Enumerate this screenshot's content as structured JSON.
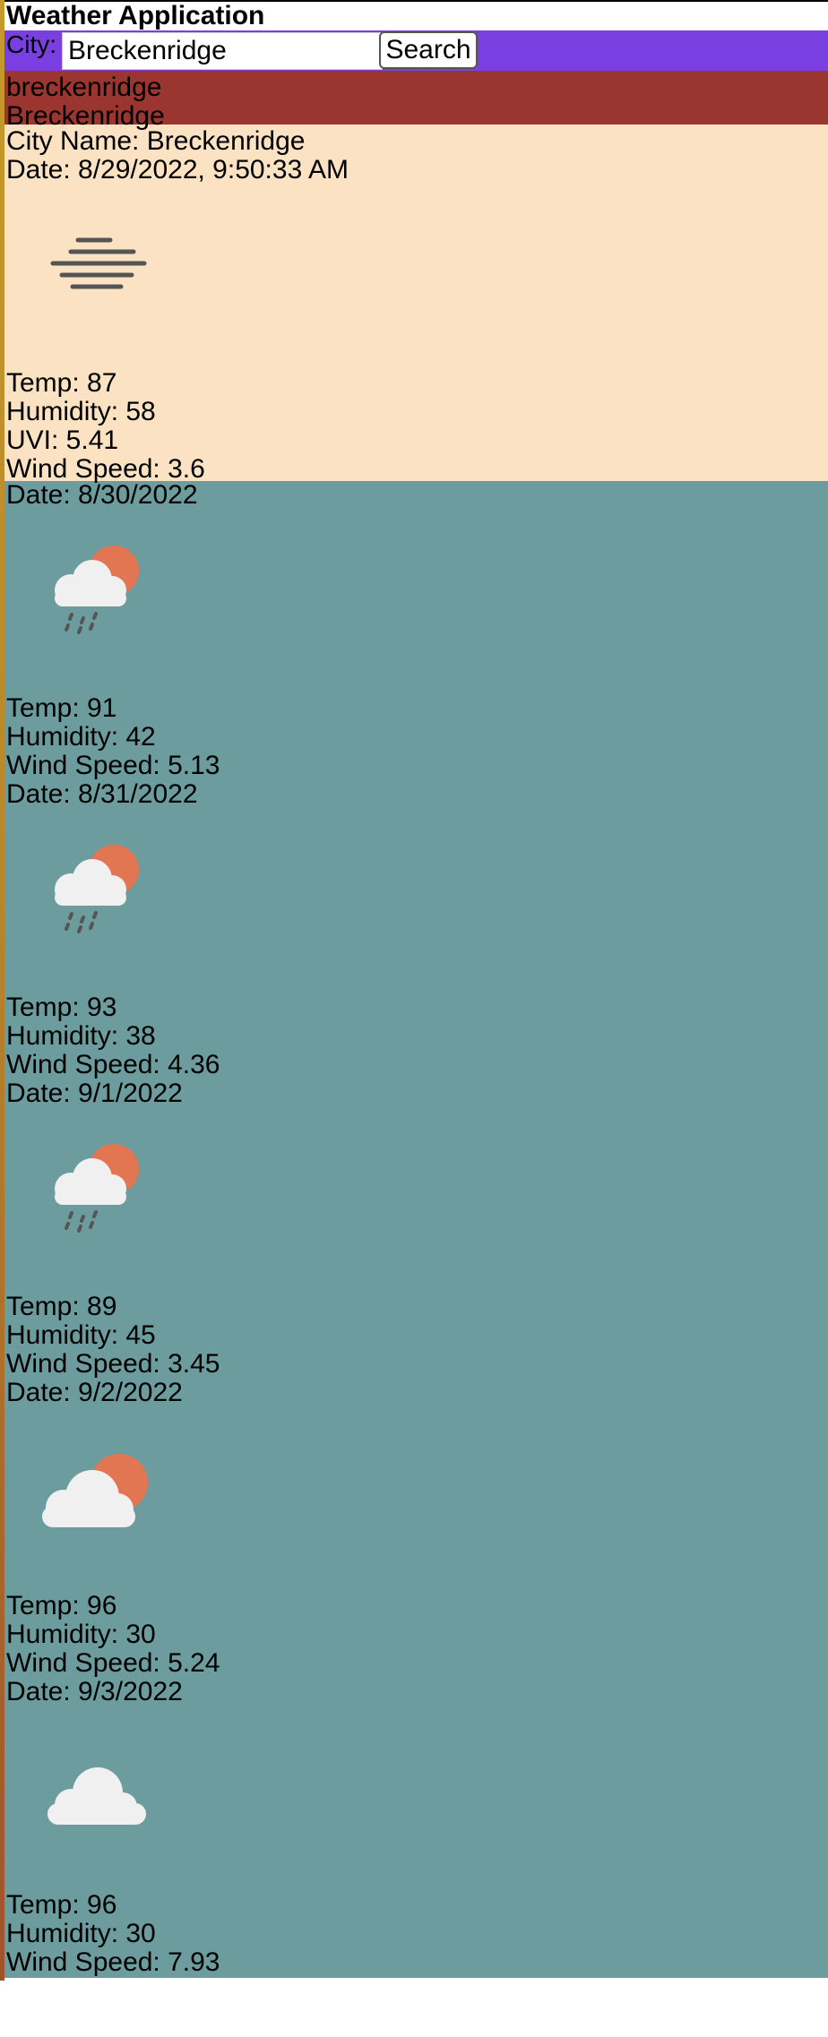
{
  "app": {
    "title": "Weather Application"
  },
  "search": {
    "label": "City:",
    "value": "Breckenridge",
    "button_label": "Search"
  },
  "history": [
    "breckenridge",
    "Breckenridge"
  ],
  "current": {
    "city_line": "City Name: Breckenridge",
    "date_line": "Date: 8/29/2022, 9:50:33 AM",
    "icon": "mist-icon",
    "temp_line": "Temp: 87",
    "humidity_line": "Humidity: 58",
    "uvi_line": "UVI: 5.41",
    "wind_line": "Wind Speed: 3.6"
  },
  "forecast": [
    {
      "date_line": "Date: 8/30/2022",
      "icon": "sun-cloud-rain-icon",
      "temp_line": "Temp: 91",
      "humidity_line": "Humidity: 42",
      "wind_line": "Wind Speed: 5.13"
    },
    {
      "date_line": "Date: 8/31/2022",
      "icon": "sun-cloud-rain-icon",
      "temp_line": "Temp: 93",
      "humidity_line": "Humidity: 38",
      "wind_line": "Wind Speed: 4.36"
    },
    {
      "date_line": "Date: 9/1/2022",
      "icon": "sun-cloud-rain-icon",
      "temp_line": "Temp: 89",
      "humidity_line": "Humidity: 45",
      "wind_line": "Wind Speed: 3.45"
    },
    {
      "date_line": "Date: 9/2/2022",
      "icon": "partly-cloudy-icon",
      "temp_line": "Temp: 96",
      "humidity_line": "Humidity: 30",
      "wind_line": "Wind Speed: 5.24"
    },
    {
      "date_line": "Date: 9/3/2022",
      "icon": "cloud-icon",
      "temp_line": "Temp: 96",
      "humidity_line": "Humidity: 30",
      "wind_line": "Wind Speed: 7.93"
    }
  ],
  "colors": {
    "search_bar": "#7a3fe0",
    "history_bg": "#9a3530",
    "current_bg": "#fae2c3",
    "forecast_bg": "#6c9c9e",
    "sun": "#e27552",
    "cloud": "#f0f0f0",
    "rain": "#555555"
  }
}
